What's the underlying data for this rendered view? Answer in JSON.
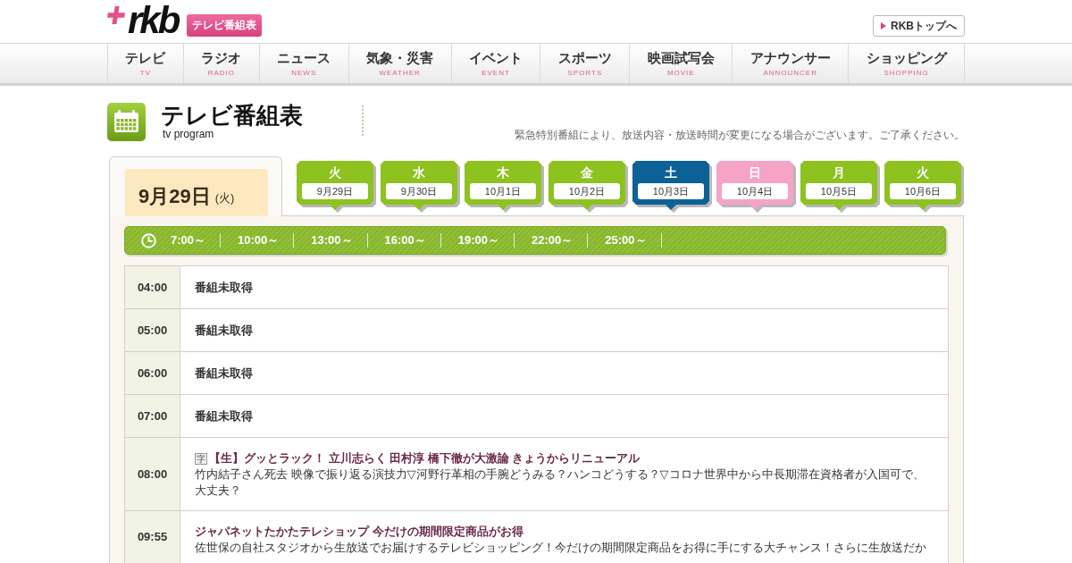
{
  "header": {
    "logo": "rkb",
    "section": "テレビ番組表",
    "top_link": "RKBトップへ"
  },
  "nav": [
    {
      "label": "テレビ",
      "sub": "TV"
    },
    {
      "label": "ラジオ",
      "sub": "RADIO"
    },
    {
      "label": "ニュース",
      "sub": "NEWS"
    },
    {
      "label": "気象・災害",
      "sub": "WEATHER"
    },
    {
      "label": "イベント",
      "sub": "EVENT"
    },
    {
      "label": "スポーツ",
      "sub": "SPORTS"
    },
    {
      "label": "映画試写会",
      "sub": "MOVIE"
    },
    {
      "label": "アナウンサー",
      "sub": "ANNOUNCER"
    },
    {
      "label": "ショッピング",
      "sub": "SHOPPING"
    }
  ],
  "page_title": {
    "title": "テレビ番組表",
    "subtitle": "tv program",
    "notice": "緊急特別番組により、放送内容・放送時間が変更になる場合がございます。ご了承ください。"
  },
  "current_date": {
    "date": "9月29日",
    "weekday": "(火)"
  },
  "days": [
    {
      "weekday": "火",
      "date": "9月29日",
      "color": "#8dc21f"
    },
    {
      "weekday": "水",
      "date": "9月30日",
      "color": "#8dc21f"
    },
    {
      "weekday": "木",
      "date": "10月1日",
      "color": "#8dc21f"
    },
    {
      "weekday": "金",
      "date": "10月2日",
      "color": "#8dc21f"
    },
    {
      "weekday": "土",
      "date": "10月3日",
      "color": "#0c6196"
    },
    {
      "weekday": "日",
      "date": "10月4日",
      "color": "#f5a3c6"
    },
    {
      "weekday": "月",
      "date": "10月5日",
      "color": "#8dc21f"
    },
    {
      "weekday": "火",
      "date": "10月6日",
      "color": "#8dc21f"
    }
  ],
  "time_bar": {
    "slots": [
      "7:00～",
      "10:00～",
      "13:00～",
      "16:00～",
      "19:00～",
      "22:00～",
      "25:00～"
    ]
  },
  "schedule": [
    {
      "kind": "unavailable",
      "time": "04:00",
      "title": "番組未取得"
    },
    {
      "kind": "unavailable",
      "time": "05:00",
      "title": "番組未取得"
    },
    {
      "kind": "unavailable",
      "time": "06:00",
      "title": "番組未取得"
    },
    {
      "kind": "unavailable",
      "time": "07:00",
      "title": "番組未取得"
    },
    {
      "kind": "program",
      "time": "08:00",
      "marks": [
        "字"
      ],
      "title": "【生】グッとラック！ 立川志らく 田村淳 橋下徹が大激論 きょうからリニューアル",
      "description": "竹内結子さん死去 映像で振り返る演技力▽河野行革相の手腕どうみる？ハンコどうする？▽コロナ世界中から中長期滞在資格者が入国可で、大丈夫？"
    },
    {
      "kind": "program",
      "time": "09:55",
      "title": "ジャパネットたかたテレショップ 今だけの期間限定商品がお得",
      "description": "佐世保の自社スタジオから生放送でお届けするテレビショッピング！今だけの期間限定商品をお得に手にする大チャンス！さらに生放送だか"
    }
  ]
}
